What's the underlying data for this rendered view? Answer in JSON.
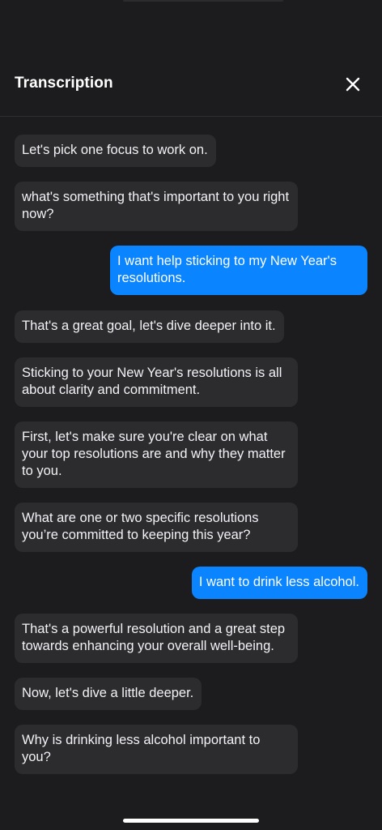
{
  "header": {
    "title": "Transcription",
    "close_icon": "close-icon"
  },
  "messages": [
    {
      "role": "assistant",
      "text": "Let's pick one focus to work on."
    },
    {
      "role": "assistant",
      "text": "what's something that's important to you right now?"
    },
    {
      "role": "user",
      "text": "I want help sticking to my New Year's resolutions."
    },
    {
      "role": "assistant",
      "text": "That's a great goal, let's dive deeper into it."
    },
    {
      "role": "assistant",
      "text": "Sticking to your New Year's resolutions is all about clarity and commitment."
    },
    {
      "role": "assistant",
      "text": "First, let's make sure you're clear on what your top resolutions are and why they matter to you."
    },
    {
      "role": "assistant",
      "text": "What are one or two specific resolutions you’re committed to keeping this year?"
    },
    {
      "role": "user",
      "text": "I want to drink less alcohol."
    },
    {
      "role": "assistant",
      "text": "That's a powerful resolution and a great step towards enhancing your overall well-being."
    },
    {
      "role": "assistant",
      "text": "Now, let's dive a little deeper."
    },
    {
      "role": "assistant",
      "text": "Why is drinking less alcohol important to you?"
    }
  ],
  "colors": {
    "background": "#1c1c1e",
    "assistant_bubble": "#2c2c2e",
    "user_bubble": "#0a84ff"
  }
}
